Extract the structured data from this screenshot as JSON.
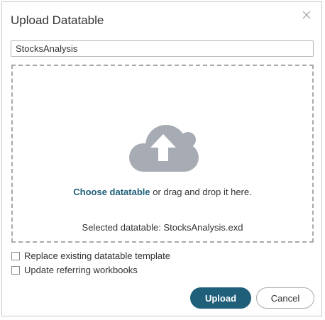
{
  "dialog": {
    "title": "Upload Datatable",
    "close_icon": "close-icon"
  },
  "name_input": {
    "value": "StocksAnalysis"
  },
  "drop_zone": {
    "icon": "cloud-upload-icon",
    "choose_link": "Choose datatable",
    "drag_text": " or drag and drop it here.",
    "selected_text": "Selected datatable: StocksAnalysis.exd"
  },
  "options": {
    "replace_label": "Replace existing datatable template",
    "replace_checked": false,
    "update_label": "Update referring workbooks",
    "update_checked": false
  },
  "buttons": {
    "upload_label": "Upload",
    "cancel_label": "Cancel"
  },
  "colors": {
    "accent": "#1f5f7a",
    "icon_gray": "#a7abb3"
  }
}
